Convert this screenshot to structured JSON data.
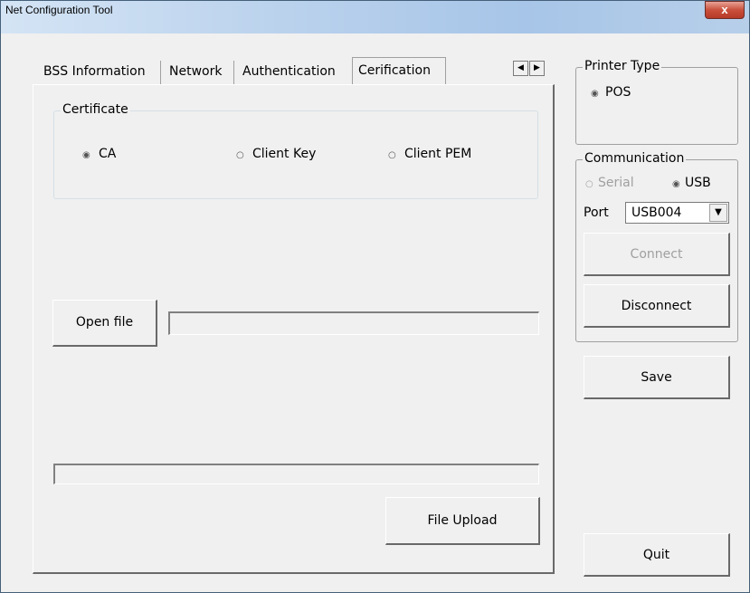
{
  "window": {
    "title": "Net Configuration Tool",
    "close_glyph": "x"
  },
  "tabs": [
    {
      "label": "BSS Information"
    },
    {
      "label": "Network"
    },
    {
      "label": "Authentication"
    },
    {
      "label": "Cerification"
    }
  ],
  "tab_scroll": {
    "left_glyph": "◀",
    "right_glyph": "▶"
  },
  "certificate": {
    "group_label": "Certificate",
    "options": [
      {
        "label": "CA",
        "selected": true
      },
      {
        "label": "Client Key",
        "selected": false
      },
      {
        "label": "Client PEM",
        "selected": false
      }
    ]
  },
  "open_file_button": "Open file",
  "file_path_value": "",
  "upload_progress_value": "",
  "file_upload_button": "File Upload",
  "printer_type": {
    "group_label": "Printer Type",
    "option": {
      "label": "POS",
      "selected": true
    }
  },
  "communication": {
    "group_label": "Communication",
    "serial_label": "Serial",
    "usb_label": "USB",
    "port_label": "Port",
    "port_value": "USB004",
    "connect_button": "Connect",
    "disconnect_button": "Disconnect"
  },
  "save_button": "Save",
  "quit_button": "Quit",
  "radio_glyphs": {
    "selected": "◉",
    "unselected": "○"
  }
}
